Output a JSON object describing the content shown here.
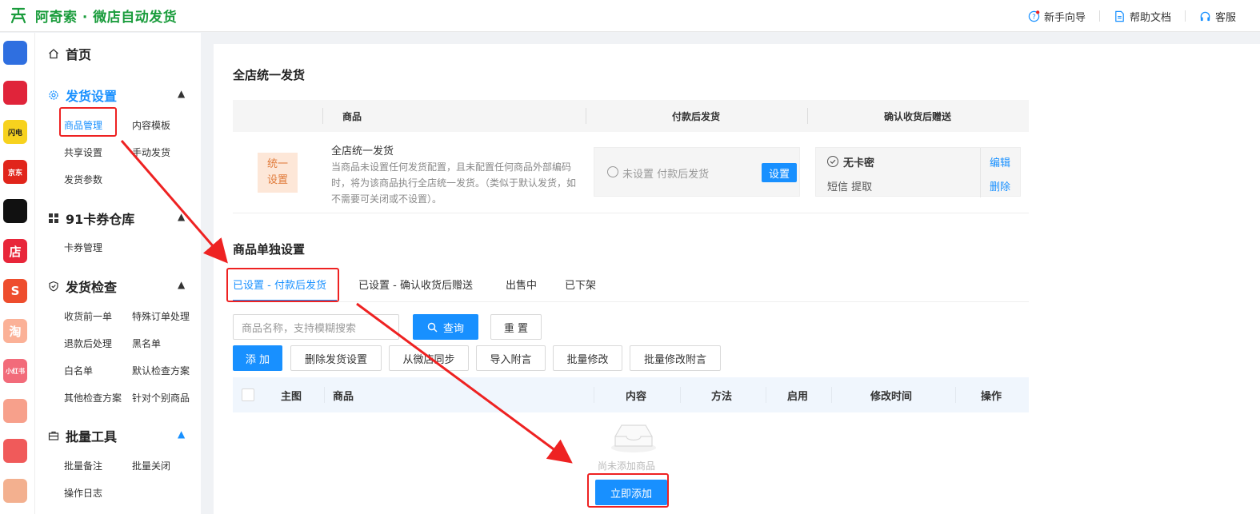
{
  "app": {
    "title": "阿奇索 · 微店自动发货"
  },
  "header_links": [
    {
      "label": "新手向导",
      "icon": "question-circle-icon"
    },
    {
      "label": "帮助文档",
      "icon": "document-icon"
    },
    {
      "label": "客服",
      "icon": "headset-icon"
    }
  ],
  "rail": [
    {
      "name": "qr-app-icon",
      "color": "#2f6fe0",
      "text": ""
    },
    {
      "name": "pinduoduo-icon",
      "color": "#e0243a",
      "text": ""
    },
    {
      "name": "flash-icon",
      "color": "#f7d21e",
      "text": "闪电"
    },
    {
      "name": "jd-icon",
      "color": "#e1251b",
      "text": "京东"
    },
    {
      "name": "douyin-icon",
      "color": "#111111",
      "text": ""
    },
    {
      "name": "weidian-icon",
      "color": "#e8263a",
      "text": "店"
    },
    {
      "name": "shopee-icon",
      "color": "#ee4d2d",
      "text": "S"
    },
    {
      "name": "taobao-icon",
      "color": "#fbb197",
      "text": "淘"
    },
    {
      "name": "xiaohongshu-icon",
      "color": "#f26b7a",
      "text": "小红书"
    },
    {
      "name": "kuaishou-icon",
      "color": "#f7a08b",
      "text": ""
    },
    {
      "name": "thumbs-up-icon",
      "color": "#f05a5a",
      "text": ""
    },
    {
      "name": "bag-icon",
      "color": "#f3b08f",
      "text": ""
    }
  ],
  "nav": {
    "home": "首页",
    "ship_settings": "发货设置",
    "ship_settings_items": [
      "商品管理",
      "内容模板",
      "共享设置",
      "手动发货",
      "发货参数"
    ],
    "card_store": "91卡券仓库",
    "card_store_items": [
      "卡券管理"
    ],
    "ship_check": "发货检查",
    "ship_check_items": [
      "收货前一单",
      "特殊订单处理",
      "退款后处理",
      "黑名单",
      "白名单",
      "默认检查方案",
      "其他检查方案",
      "针对个别商品"
    ],
    "batch_tools": "批量工具",
    "batch_tools_items": [
      "批量备注",
      "批量关闭",
      "操作日志"
    ]
  },
  "unified": {
    "section_title": "全店统一发货",
    "headers": [
      "商品",
      "付款后发货",
      "确认收货后赠送"
    ],
    "tag_line1": "统一",
    "tag_line2": "设置",
    "title": "全店统一发货",
    "desc": "当商品未设置任何发货配置，且未配置任何商品外部编码时，将为该商品执行全店统一发货。（类似于默认发货，如不需要可关闭或不设置）。",
    "pay_status": "未设置 付款后发货",
    "set_button": "设置",
    "no_card": "无卡密",
    "sms": "短信  提取",
    "edit": "编辑",
    "delete": "删除"
  },
  "single": {
    "section_title": "商品单独设置",
    "tabs": [
      "已设置 - 付款后发货",
      "已设置 - 确认收货后赠送",
      "出售中",
      "已下架"
    ],
    "search_placeholder": "商品名称，支持模糊搜索",
    "query_button": "查询",
    "reset_button": "重 置",
    "action_buttons": [
      "添 加",
      "删除发货设置",
      "从微店同步",
      "导入附言",
      "批量修改",
      "批量修改附言"
    ],
    "columns": [
      "主图",
      "商品",
      "内容",
      "方法",
      "启用",
      "修改时间",
      "操作"
    ],
    "empty_text": "尚未添加商品",
    "add_now_button": "立即添加"
  },
  "colors": {
    "brand_green": "#1a9c3c",
    "accent_blue": "#1890ff",
    "annotation_red": "#ee2222"
  }
}
